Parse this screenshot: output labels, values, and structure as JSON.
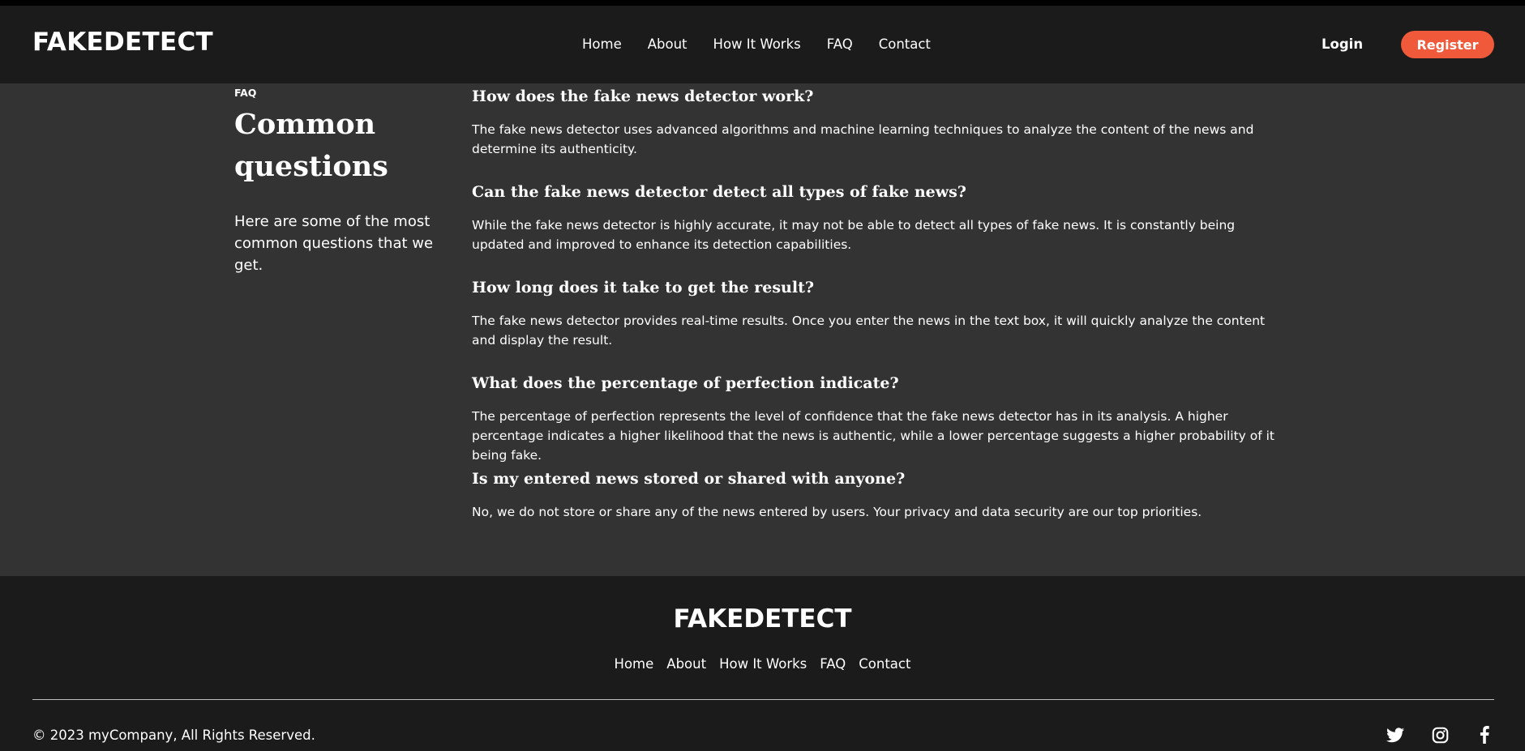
{
  "header": {
    "logo": "FAKEDETECT",
    "nav": [
      "Home",
      "About",
      "How It Works",
      "FAQ",
      "Contact"
    ],
    "login_label": "Login",
    "register_label": "Register"
  },
  "faq": {
    "eyebrow": "FAQ",
    "title_line1": "Common",
    "title_line2": "questions",
    "intro": "Here are some of the most common questions that we get.",
    "items": [
      {
        "question": "How does the fake news detector work?",
        "answer": "The fake news detector uses advanced algorithms and machine learning techniques to analyze the content of the news and determine its authenticity."
      },
      {
        "question": "Can the fake news detector detect all types of fake news?",
        "answer": "While the fake news detector is highly accurate, it may not be able to detect all types of fake news. It is constantly being updated and improved to enhance its detection capabilities."
      },
      {
        "question": "How long does it take to get the result?",
        "answer": "The fake news detector provides real-time results. Once you enter the news in the text box, it will quickly analyze the content and display the result."
      },
      {
        "question": "What does the percentage of perfection indicate?",
        "answer": "The percentage of perfection represents the level of confidence that the fake news detector has in its analysis. A higher percentage indicates a higher likelihood that the news is authentic, while a lower percentage suggests a higher probability of it being fake."
      },
      {
        "question": "Is my entered news stored or shared with anyone?",
        "answer": "No, we do not store or share any of the news entered by users. Your privacy and data security are our top priorities."
      }
    ]
  },
  "footer": {
    "logo": "FAKEDETECT",
    "nav": [
      "Home",
      "About",
      "How It Works",
      "FAQ",
      "Contact"
    ],
    "copyright": "© 2023 myCompany, All Rights Reserved.",
    "socials": [
      "twitter-icon",
      "instagram-icon",
      "facebook-icon"
    ]
  },
  "colors": {
    "accent": "#f05a3a",
    "header_bg": "#1b1b1b",
    "section_bg": "#333333"
  }
}
